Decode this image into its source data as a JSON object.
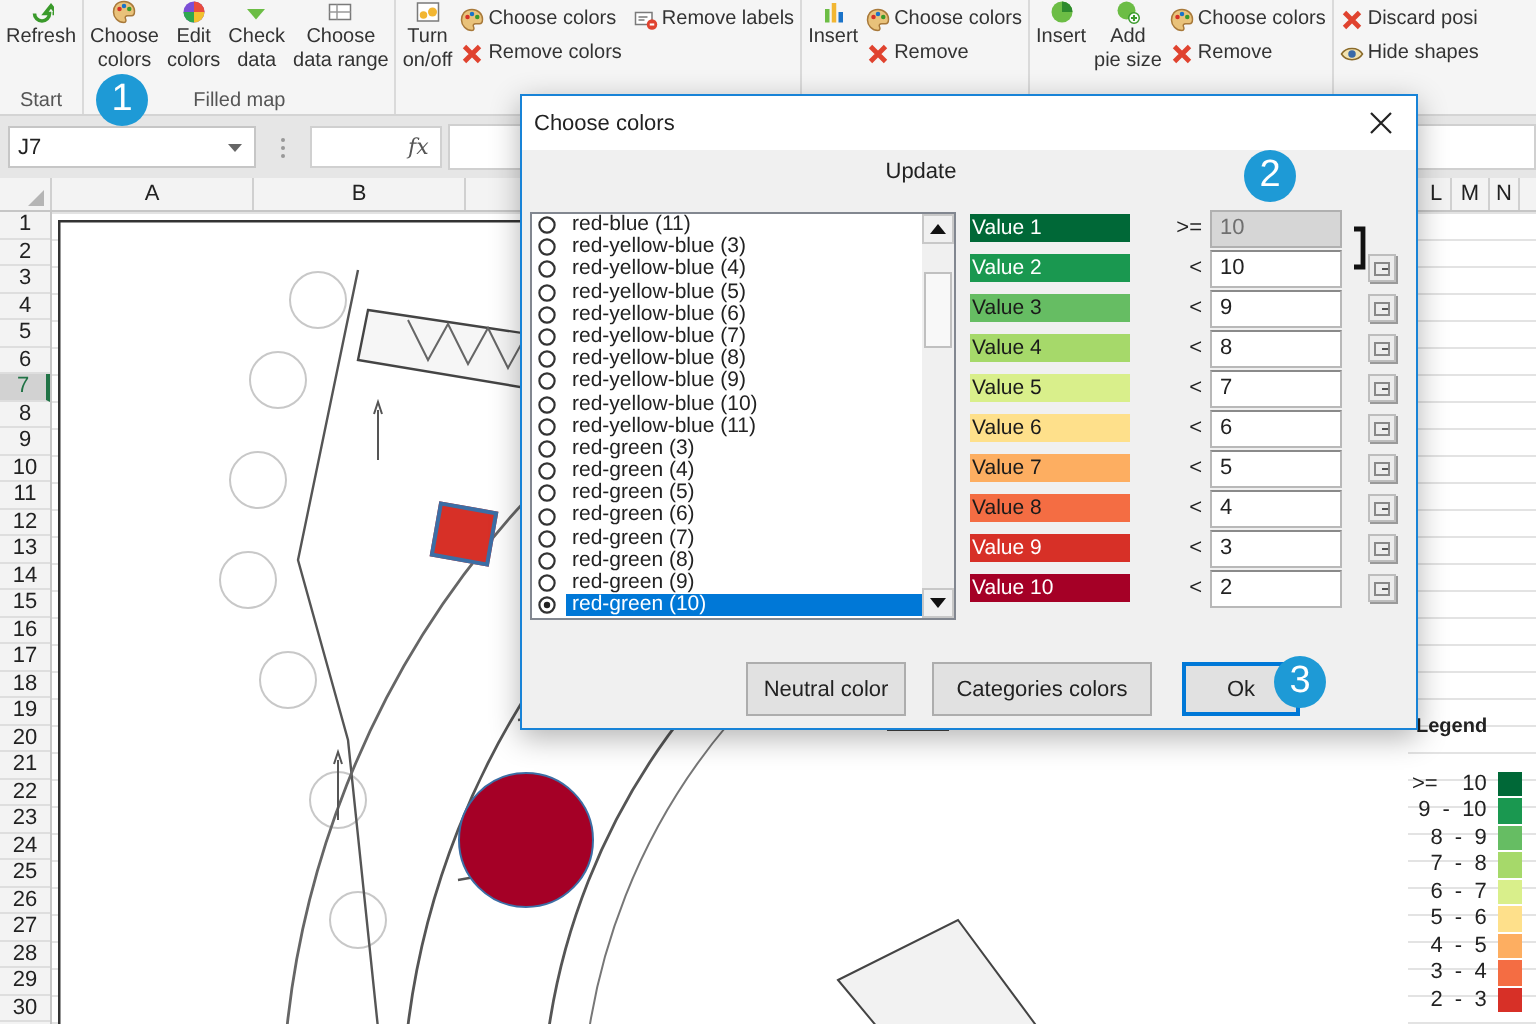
{
  "ribbon": {
    "groups": [
      {
        "label": "Start",
        "items": [
          {
            "kind": "large",
            "label": "Refresh"
          }
        ]
      },
      {
        "label": "Filled map",
        "items": [
          {
            "kind": "large",
            "label": "Choose\ncolors"
          },
          {
            "kind": "large",
            "label": "Edit\ncolors"
          },
          {
            "kind": "large",
            "label": "Check\ndata"
          },
          {
            "kind": "large",
            "label": "Choose\ndata range"
          }
        ]
      },
      {
        "items": [
          {
            "kind": "large",
            "label": "Turn\non/off"
          },
          {
            "kind": "small",
            "label": "Choose colors"
          },
          {
            "kind": "small",
            "label": "Remove colors"
          },
          {
            "kind": "small",
            "label": "Remove labels"
          }
        ]
      },
      {
        "items": [
          {
            "kind": "large",
            "label": "Insert"
          },
          {
            "kind": "small",
            "label": "Choose colors"
          },
          {
            "kind": "small",
            "label": "Remove"
          }
        ]
      },
      {
        "items": [
          {
            "kind": "large",
            "label": "Insert"
          },
          {
            "kind": "large",
            "label": "Add\npie size"
          },
          {
            "kind": "small",
            "label": "Choose colors"
          },
          {
            "kind": "small",
            "label": "Remove"
          }
        ]
      },
      {
        "items": [
          {
            "kind": "small",
            "label": "Discard posi"
          },
          {
            "kind": "small",
            "label": "Hide shapes"
          }
        ]
      }
    ]
  },
  "formula_bar": {
    "name_box": "J7",
    "function_label": "fx"
  },
  "sheet": {
    "columns": [
      "A",
      "B",
      "L",
      "M",
      "N"
    ],
    "rows": [
      {
        "label": "1",
        "selected": false
      },
      {
        "label": "2",
        "selected": false
      },
      {
        "label": "3",
        "selected": false
      },
      {
        "label": "4",
        "selected": false
      },
      {
        "label": "5",
        "selected": false
      },
      {
        "label": "6",
        "selected": false
      },
      {
        "label": "7",
        "selected": true
      },
      {
        "label": "8",
        "selected": false
      },
      {
        "label": "9",
        "selected": false
      },
      {
        "label": "10",
        "selected": false
      },
      {
        "label": "11",
        "selected": false
      },
      {
        "label": "12",
        "selected": false
      },
      {
        "label": "13",
        "selected": false
      },
      {
        "label": "14",
        "selected": false
      },
      {
        "label": "15",
        "selected": false
      },
      {
        "label": "16",
        "selected": false
      },
      {
        "label": "17",
        "selected": false
      },
      {
        "label": "18",
        "selected": false
      },
      {
        "label": "19",
        "selected": false
      },
      {
        "label": "20",
        "selected": false
      },
      {
        "label": "21",
        "selected": false
      },
      {
        "label": "22",
        "selected": false
      },
      {
        "label": "23",
        "selected": false
      },
      {
        "label": "24",
        "selected": false
      },
      {
        "label": "25",
        "selected": false
      },
      {
        "label": "26",
        "selected": false
      },
      {
        "label": "27",
        "selected": false
      },
      {
        "label": "28",
        "selected": false
      },
      {
        "label": "29",
        "selected": false
      },
      {
        "label": "30",
        "selected": false
      }
    ],
    "plan": {
      "kind": "picture"
    },
    "map_shapes": [
      {
        "kind": "region",
        "color": "#d73027"
      },
      {
        "kind": "bubble",
        "color": "#a50026"
      }
    ],
    "legend": {
      "title": "Legend",
      "items": [
        {
          "label": ">=    10",
          "color": "#006837"
        },
        {
          "label": "9  -  10",
          "color": "#1a9850"
        },
        {
          "label": "8  -  9",
          "color": "#66bd63"
        },
        {
          "label": "7  -  8",
          "color": "#a6d96a"
        },
        {
          "label": "6  -  7",
          "color": "#d9ef8b"
        },
        {
          "label": "5  -  6",
          "color": "#fee08b"
        },
        {
          "label": "4  -  5",
          "color": "#fdae61"
        },
        {
          "label": "3  -  4",
          "color": "#f46d43"
        },
        {
          "label": "2  -  3",
          "color": "#d73027"
        }
      ]
    }
  },
  "dialog": {
    "title": "Choose colors",
    "update_label": "Update",
    "palettes": [
      {
        "label": "red-blue (11)",
        "selected": false
      },
      {
        "label": "red-yellow-blue (3)",
        "selected": false
      },
      {
        "label": "red-yellow-blue (4)",
        "selected": false
      },
      {
        "label": "red-yellow-blue (5)",
        "selected": false
      },
      {
        "label": "red-yellow-blue (6)",
        "selected": false
      },
      {
        "label": "red-yellow-blue (7)",
        "selected": false
      },
      {
        "label": "red-yellow-blue (8)",
        "selected": false
      },
      {
        "label": "red-yellow-blue (9)",
        "selected": false
      },
      {
        "label": "red-yellow-blue (10)",
        "selected": false
      },
      {
        "label": "red-yellow-blue (11)",
        "selected": false
      },
      {
        "label": "red-green (3)",
        "selected": false
      },
      {
        "label": "red-green (4)",
        "selected": false
      },
      {
        "label": "red-green (5)",
        "selected": false
      },
      {
        "label": "red-green (6)",
        "selected": false
      },
      {
        "label": "red-green (7)",
        "selected": false
      },
      {
        "label": "red-green (8)",
        "selected": false
      },
      {
        "label": "red-green (9)",
        "selected": false
      },
      {
        "label": "red-green (10)",
        "selected": true
      }
    ],
    "thresholds": [
      {
        "name": "Value 1",
        "color": "#006837",
        "operator": ">=",
        "value": "10",
        "disabled": true
      },
      {
        "name": "Value 2",
        "color": "#1a9850",
        "operator": "<",
        "value": "10",
        "disabled": false
      },
      {
        "name": "Value 3",
        "color": "#66bd63",
        "operator": "<",
        "value": "9",
        "disabled": false
      },
      {
        "name": "Value 4",
        "color": "#a6d96a",
        "operator": "<",
        "value": "8",
        "disabled": false
      },
      {
        "name": "Value 5",
        "color": "#d9ef8b",
        "operator": "<",
        "value": "7",
        "disabled": false
      },
      {
        "name": "Value 6",
        "color": "#fee08b",
        "operator": "<",
        "value": "6",
        "disabled": false
      },
      {
        "name": "Value 7",
        "color": "#fdae61",
        "operator": "<",
        "value": "5",
        "disabled": false
      },
      {
        "name": "Value 8",
        "color": "#f46d43",
        "operator": "<",
        "value": "4",
        "disabled": false
      },
      {
        "name": "Value 9",
        "color": "#d73027",
        "operator": "<",
        "value": "3",
        "disabled": false
      },
      {
        "name": "Value 10",
        "color": "#a50026",
        "operator": "<",
        "value": "2",
        "disabled": false
      }
    ],
    "buttons": [
      {
        "label": "Neutral color",
        "default": false
      },
      {
        "label": "Categories colors",
        "default": false
      },
      {
        "label": "Ok",
        "default": true
      }
    ]
  },
  "callouts": [
    "1",
    "2",
    "3"
  ]
}
